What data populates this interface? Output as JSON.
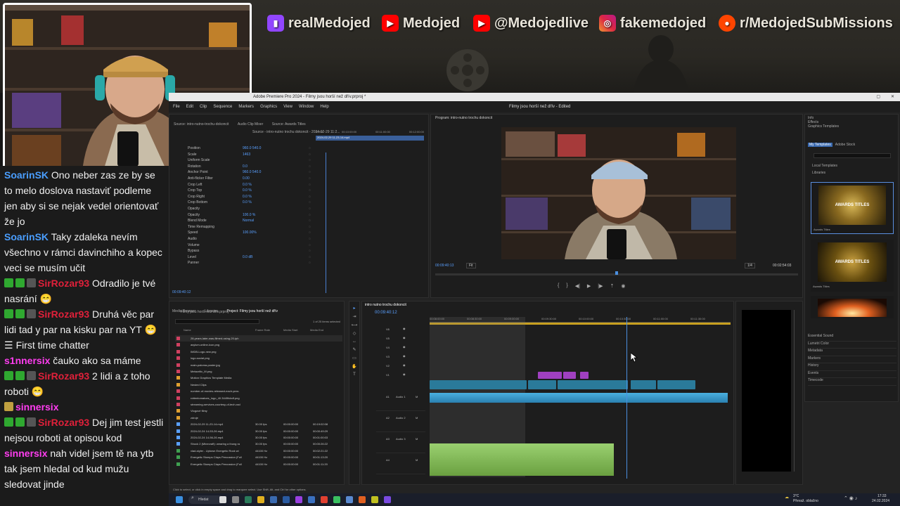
{
  "overlay": {
    "socials": [
      {
        "platform": "twitch",
        "handle": "realMedojed",
        "color": "#9146ff"
      },
      {
        "platform": "youtube",
        "handle": "Medojed",
        "color": "#ff0000"
      },
      {
        "platform": "youtube",
        "handle": "@Medojedlive",
        "color": "#ff0000"
      },
      {
        "platform": "instagram",
        "handle": "fakemedojed",
        "color": "#d6249f"
      },
      {
        "platform": "reddit",
        "handle": "r/MedojedSubMissions",
        "color": "#ff4500"
      }
    ]
  },
  "chat": {
    "messages": [
      {
        "user": "SoarinSK",
        "user_color": "#4a9eff",
        "badges": [],
        "text": "Ono neber zas ze by se to melo doslova nastaviť podleme jen aby si se nejak vedel orientovať že jo"
      },
      {
        "user": "SoarinSK",
        "user_color": "#4a9eff",
        "badges": [],
        "text": "Taky zdaleka nevím všechno v rámci davinchiho a kopec veci se musím učit"
      },
      {
        "user": "SirRozar93",
        "user_color": "#e0203a",
        "badges": [
          "check",
          "mod",
          "sub"
        ],
        "text": "Odradilo je tvé nasrání 😁"
      },
      {
        "user": "SirRozar93",
        "user_color": "#e0203a",
        "badges": [
          "check",
          "mod",
          "sub"
        ],
        "text": "Druhá věc par lidi tad y par na kisku par na YT 😁"
      },
      {
        "user": "",
        "user_color": "#ffffff",
        "badges": [],
        "text": "First time chatter",
        "system": true
      },
      {
        "user": "s1nnersix",
        "user_color": "#ff3df0",
        "badges": [],
        "text": "čauko ako sa máme"
      },
      {
        "user": "SirRozar93",
        "user_color": "#e0203a",
        "badges": [
          "check",
          "mod",
          "sub"
        ],
        "text": "2 lidi a z toho roboti 😁"
      },
      {
        "user": "sinnersix",
        "user_color": "#ff3df0",
        "badges": [
          "bits"
        ],
        "text": ""
      },
      {
        "user": "SirRozar93",
        "user_color": "#e0203a",
        "badges": [
          "check",
          "mod",
          "sub"
        ],
        "text": "Dej jim test jestli nejsou roboti at opisou kod"
      },
      {
        "user": "sinnersix",
        "user_color": "#ff3df0",
        "badges": [],
        "text": "nah videl jsem tě na ytb tak jsem hledal od kud mužu sledovat jinde"
      }
    ]
  },
  "premiere": {
    "title": "Adobe Premiere Pro 2024 - Filmy jsou horší než dřív.prproj *",
    "menus": [
      "File",
      "Edit",
      "Clip",
      "Sequence",
      "Markers",
      "Graphics",
      "View",
      "Window",
      "Help"
    ],
    "header_center": "Filmy jsou horší než dřív - Edited",
    "source_tabs": [
      "Source: intro-nutno-trochu-dokoncit",
      "Audio Clip Mixer",
      "Source: Awards Titles"
    ],
    "effect_controls": {
      "clip": "Source - intro-nutno trochu dokoncit - 2024-02-29 11:2...",
      "timecodes": [
        "00:00",
        "00:10:00:00",
        "00:11:00:00",
        "00:12:00:00"
      ],
      "clip_label": "2024-02-29 11-23-14.mp4",
      "rows": [
        {
          "label": "Position",
          "value": "960.0   540.0"
        },
        {
          "label": "Scale",
          "value": "1463"
        },
        {
          "label": "Uniform Scale",
          "value": ""
        },
        {
          "label": "Rotation",
          "value": "0.0"
        },
        {
          "label": "Anchor Point",
          "value": "960.0   540.0"
        },
        {
          "label": "Anti-flicker Filter",
          "value": "0.00"
        },
        {
          "label": "Crop Left",
          "value": "0.0 %"
        },
        {
          "label": "Crop Top",
          "value": "0.0 %"
        },
        {
          "label": "Crop Right",
          "value": "0.0 %"
        },
        {
          "label": "Crop Bottom",
          "value": "0.0 %"
        },
        {
          "label": "Opacity",
          "value": ""
        },
        {
          "label": "Opacity",
          "value": "100.0 %"
        },
        {
          "label": "Blend Mode",
          "value": "Normal"
        },
        {
          "label": "Time Remapping",
          "value": ""
        },
        {
          "label": "Speed",
          "value": "100.00%"
        },
        {
          "label": "Audio",
          "value": ""
        },
        {
          "label": "Volume",
          "value": ""
        },
        {
          "label": "Bypass",
          "value": ""
        },
        {
          "label": "Level",
          "value": "0.0 dB"
        },
        {
          "label": "Panner",
          "value": ""
        }
      ],
      "timecode": "00:09:40:12"
    },
    "program": {
      "tab": "Program: intro-nutno trochu dokoncit",
      "timecode": "00:09:40:13",
      "fit": "Fit",
      "quality": "1/4",
      "duration": "00:02:54:03"
    },
    "right_panel": {
      "tabs": [
        "Info",
        "Effects",
        "Graphics Templates"
      ],
      "subtabs": [
        "My Templates",
        "Adobe Stock"
      ],
      "folders": [
        "Local Templates",
        "Libraries"
      ],
      "templates": [
        {
          "name": "Awards Titles",
          "label": "AWARDS TITLES"
        },
        {
          "name": "Awards Titles",
          "label": "AWARDS TITLES"
        },
        {
          "name": "",
          "label": ""
        }
      ],
      "sections": [
        "Essential Sound",
        "Lumetri Color",
        "Metadata",
        "Markers",
        "History",
        "Events",
        "Timecode"
      ]
    },
    "project": {
      "tabs": [
        "Media Browser",
        "Libraries",
        "Project: Filmy jsou horší než dřív"
      ],
      "path": "Filmy jsou horší než dřív.prproj",
      "selection": "1 of 25 items selected",
      "columns": [
        "Name",
        "Frame Rate",
        "Media Start",
        "Media End"
      ],
      "items": [
        {
          "name": "28-years-later-was-filmed-using-20-iph",
          "rate": "",
          "start": "",
          "end": "",
          "color": "#d04060"
        },
        {
          "name": "asylum-online-icon.png",
          "rate": "",
          "start": "",
          "end": "",
          "color": "#d04060"
        },
        {
          "name": "IMDB-Logo-new.png",
          "rate": "",
          "start": "",
          "end": "",
          "color": "#d04060"
        },
        {
          "name": "logo-social.png",
          "rate": "",
          "start": "",
          "end": "",
          "color": "#d04060"
        },
        {
          "name": "main-paloma-poster.jpg",
          "rate": "",
          "start": "",
          "end": "",
          "color": "#d04060"
        },
        {
          "name": "Metacritic_M.png",
          "rate": "",
          "start": "",
          "end": "",
          "color": "#d04060"
        },
        {
          "name": "Motion Graphics Template Media",
          "rate": "",
          "start": "",
          "end": "",
          "color": "#e0a030"
        },
        {
          "name": "Nested Clips",
          "rate": "",
          "start": "",
          "end": "",
          "color": "#e0a030"
        },
        {
          "name": "number-of-movies-released-each-year-",
          "rate": "",
          "start": "",
          "end": "",
          "color": "#d04060"
        },
        {
          "name": "rottentomatoes_logo_40.3449fcbdf.png",
          "rate": "",
          "start": "",
          "end": "",
          "color": "#d04060"
        },
        {
          "name": "streaming-services-courtesy-of-tech-rad",
          "rate": "",
          "start": "",
          "end": "",
          "color": "#d04060"
        },
        {
          "name": "Vlogové filmy",
          "rate": "",
          "start": "",
          "end": "",
          "color": "#e0a030"
        },
        {
          "name": "zdroje",
          "rate": "",
          "start": "",
          "end": "",
          "color": "#e0a030"
        },
        {
          "name": "2024-02-29 11-23-14.mp4",
          "rate": "30.00 fps",
          "start": "00:00:00:00",
          "end": "00:19:02:08",
          "color": "#5aa0ff"
        },
        {
          "name": "2024-02-24 14-53-26.mp4",
          "rate": "30.00 fps",
          "start": "00:00:00:00",
          "end": "00:00:49:29",
          "color": "#5aa0ff"
        },
        {
          "name": "2024-02-24 14-56-26.mp4",
          "rate": "30.00 fps",
          "start": "00:00:00:00",
          "end": "00:01:00:03",
          "color": "#5aa0ff"
        },
        {
          "name": "Shock 2 (Minecraft): wearing a thong ra",
          "rate": "30.00 fps",
          "start": "00:00:00:00",
          "end": "00:00:26:22",
          "color": "#5aa0ff"
        },
        {
          "name": "vlad-styler - Uptown Energetic Rock wi",
          "rate": "44100 Hz",
          "start": "00:00:00:00",
          "end": "00:02:21:22",
          "color": "#3fa050"
        },
        {
          "name": "Energetic Stomps Claps Percussion (Full",
          "rate": "44100 Hz",
          "start": "00:00:00:00",
          "end": "00:01:13:20",
          "color": "#3fa050"
        },
        {
          "name": "Energetic Stomps Claps Percussion (Full",
          "rate": "44100 Hz",
          "start": "00:00:00:00",
          "end": "00:01:11:20",
          "color": "#3fa050"
        }
      ]
    },
    "timeline": {
      "tab": "intro nutno trochu dokoncit",
      "timecode": "00:09:40:12",
      "tracks_video": [
        "V6",
        "V5",
        "V4",
        "V3",
        "V2",
        "V1"
      ],
      "tracks_audio": [
        "A1",
        "A2",
        "A3",
        "A4"
      ],
      "audio_names": [
        "Audio 1",
        "Audio 2",
        "Audio 3"
      ],
      "ruler": [
        "00:08:00:00",
        "00:08:30:00",
        "00:09:00:00",
        "00:09:30:00",
        "00:10:00:00",
        "00:10:30:00",
        "00:11:00:00",
        "00:11:30:00"
      ]
    },
    "status": "Click to select, or click in empty space and drag to marquee select. Use Shift, Alt, and Ctrl for other options."
  },
  "taskbar": {
    "search": "Hledat",
    "weather_temp": "3°C",
    "weather_text": "Převaž. oblačno",
    "time": "17:33",
    "date": "24.02.2024"
  }
}
